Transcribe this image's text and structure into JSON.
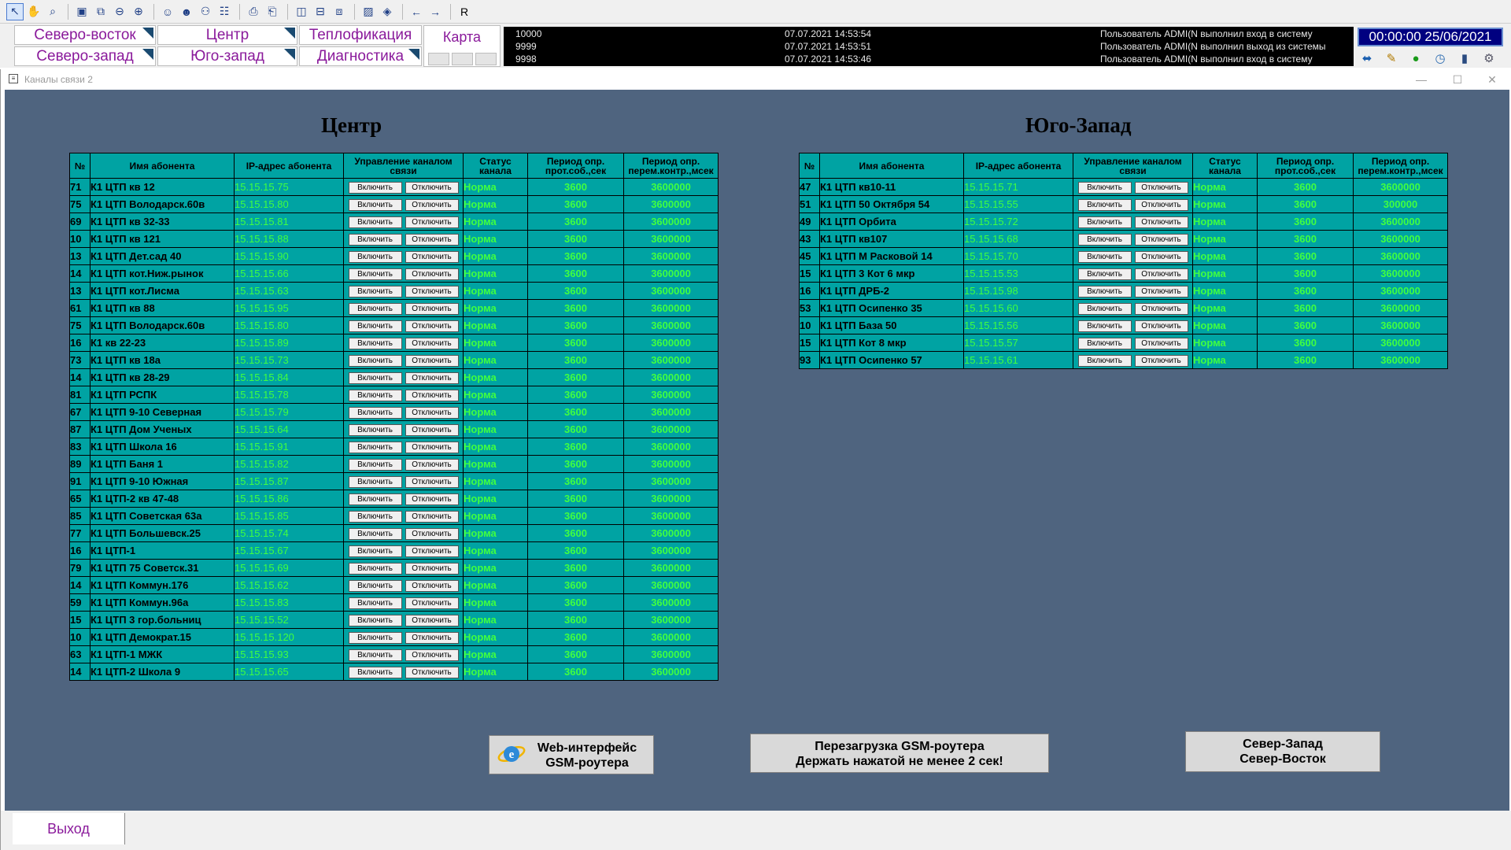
{
  "toolbar": {
    "last_label": "R"
  },
  "nav": {
    "northeast": "Северо-восток",
    "center": "Центр",
    "heating": "Теплофикация",
    "northwest": "Северо-запад",
    "southwest": "Юго-запад",
    "diagnostics": "Диагностика",
    "map": "Карта"
  },
  "eventlog": [
    {
      "code": "10000",
      "time": "07.07.2021 14:53:54",
      "msg": "Пользователь ADMI(N выполнил вход в систему"
    },
    {
      "code": "9999",
      "time": "07.07.2021 14:53:51",
      "msg": "Пользователь ADMI(N выполнил выход из системы"
    },
    {
      "code": "9998",
      "time": "07.07.2021 14:53:46",
      "msg": "Пользователь ADMI(N выполнил вход в систему"
    }
  ],
  "clock": "00:00:00 25/06/2021",
  "window": {
    "title": "Каналы связи 2",
    "minimize": "—",
    "maximize": "☐",
    "close": "✕"
  },
  "headers": {
    "num": "№",
    "name": "Имя абонента",
    "ip": "IP-адрес абонента",
    "ctrl": "Управление каналом связи",
    "status": "Статус канала",
    "p1": "Период опр. прот.соб.,сек",
    "p2": "Период опр. перем.контр.,мсек"
  },
  "buttons": {
    "on": "Включить",
    "off": "Отключить"
  },
  "center": {
    "title": "Центр",
    "rows": [
      {
        "num": "71",
        "name": "К1 ЦТП кв 12",
        "ip": "15.15.15.75",
        "status": "Норма",
        "p1": "3600",
        "p2": "3600000"
      },
      {
        "num": "75",
        "name": "К1 ЦТП Володарск.60в",
        "ip": "15.15.15.80",
        "status": "Норма",
        "p1": "3600",
        "p2": "3600000"
      },
      {
        "num": "69",
        "name": "К1 ЦТП кв 32-33",
        "ip": "15.15.15.81",
        "status": "Норма",
        "p1": "3600",
        "p2": "3600000"
      },
      {
        "num": "10",
        "name": "К1 ЦТП кв 121",
        "ip": "15.15.15.88",
        "status": "Норма",
        "p1": "3600",
        "p2": "3600000"
      },
      {
        "num": "13",
        "name": "К1 ЦТП Дет.сад 40",
        "ip": "15.15.15.90",
        "status": "Норма",
        "p1": "3600",
        "p2": "3600000"
      },
      {
        "num": "14",
        "name": "К1 ЦТП кот.Ниж.рынок",
        "ip": "15.15.15.66",
        "status": "Норма",
        "p1": "3600",
        "p2": "3600000"
      },
      {
        "num": "13",
        "name": "К1 ЦТП кот.Лисма",
        "ip": "15.15.15.63",
        "status": "Норма",
        "p1": "3600",
        "p2": "3600000"
      },
      {
        "num": "61",
        "name": "К1 ЦТП кв 88",
        "ip": "15.15.15.95",
        "status": "Норма",
        "p1": "3600",
        "p2": "3600000"
      },
      {
        "num": "75",
        "name": "К1 ЦТП Володарск.60в",
        "ip": "15.15.15.80",
        "status": "Норма",
        "p1": "3600",
        "p2": "3600000"
      },
      {
        "num": "16",
        "name": "К1 кв 22-23",
        "ip": "15.15.15.89",
        "status": "Норма",
        "p1": "3600",
        "p2": "3600000"
      },
      {
        "num": "73",
        "name": "К1 ЦТП кв 18а",
        "ip": "15.15.15.73",
        "status": "Норма",
        "p1": "3600",
        "p2": "3600000"
      },
      {
        "num": "14",
        "name": "К1 ЦТП кв 28-29",
        "ip": "15.15.15.84",
        "status": "Норма",
        "p1": "3600",
        "p2": "3600000"
      },
      {
        "num": "81",
        "name": "К1 ЦТП РСПК",
        "ip": "15.15.15.78",
        "status": "Норма",
        "p1": "3600",
        "p2": "3600000"
      },
      {
        "num": "67",
        "name": "К1 ЦТП 9-10 Северная",
        "ip": "15.15.15.79",
        "status": "Норма",
        "p1": "3600",
        "p2": "3600000"
      },
      {
        "num": "87",
        "name": "К1 ЦТП Дом Ученых",
        "ip": "15.15.15.64",
        "status": "Норма",
        "p1": "3600",
        "p2": "3600000"
      },
      {
        "num": "83",
        "name": "К1 ЦТП Школа 16",
        "ip": "15.15.15.91",
        "status": "Норма",
        "p1": "3600",
        "p2": "3600000"
      },
      {
        "num": "89",
        "name": "К1 ЦТП Баня 1",
        "ip": "15.15.15.82",
        "status": "Норма",
        "p1": "3600",
        "p2": "3600000"
      },
      {
        "num": "91",
        "name": "К1 ЦТП 9-10 Южная",
        "ip": "15.15.15.87",
        "status": "Норма",
        "p1": "3600",
        "p2": "3600000"
      },
      {
        "num": "65",
        "name": "К1 ЦТП-2 кв 47-48",
        "ip": "15.15.15.86",
        "status": "Норма",
        "p1": "3600",
        "p2": "3600000"
      },
      {
        "num": "85",
        "name": "К1 ЦТП Советская 63а",
        "ip": "15.15.15.85",
        "status": "Норма",
        "p1": "3600",
        "p2": "3600000"
      },
      {
        "num": "77",
        "name": "К1 ЦТП Большевск.25",
        "ip": "15.15.15.74",
        "status": "Норма",
        "p1": "3600",
        "p2": "3600000"
      },
      {
        "num": "16",
        "name": "К1 ЦТП-1",
        "ip": "15.15.15.67",
        "status": "Норма",
        "p1": "3600",
        "p2": "3600000"
      },
      {
        "num": "79",
        "name": "К1 ЦТП 75 Советск.31",
        "ip": "15.15.15.69",
        "status": "Норма",
        "p1": "3600",
        "p2": "3600000"
      },
      {
        "num": "14",
        "name": "К1 ЦТП Коммун.176",
        "ip": "15.15.15.62",
        "status": "Норма",
        "p1": "3600",
        "p2": "3600000"
      },
      {
        "num": "59",
        "name": "К1 ЦТП Коммун.96а",
        "ip": "15.15.15.83",
        "status": "Норма",
        "p1": "3600",
        "p2": "3600000"
      },
      {
        "num": "15",
        "name": "К1 ЦТП 3 гор.больниц",
        "ip": "15.15.15.52",
        "status": "Норма",
        "p1": "3600",
        "p2": "3600000"
      },
      {
        "num": "10",
        "name": "К1 ЦТП Демократ.15",
        "ip": "15.15.15.120",
        "status": "Норма",
        "p1": "3600",
        "p2": "3600000"
      },
      {
        "num": "63",
        "name": "К1 ЦТП-1 МЖК",
        "ip": "15.15.15.93",
        "status": "Норма",
        "p1": "3600",
        "p2": "3600000"
      },
      {
        "num": "14",
        "name": "К1 ЦТП-2 Школа 9",
        "ip": "15.15.15.65",
        "status": "Норма",
        "p1": "3600",
        "p2": "3600000"
      }
    ]
  },
  "southwest": {
    "title": "Юго-Запад",
    "rows": [
      {
        "num": "47",
        "name": "К1 ЦТП кв10-11",
        "ip": "15.15.15.71",
        "status": "Норма",
        "p1": "3600",
        "p2": "3600000"
      },
      {
        "num": "51",
        "name": "К1 ЦТП 50 Октября 54",
        "ip": "15.15.15.55",
        "status": "Норма",
        "p1": "3600",
        "p2": "300000"
      },
      {
        "num": "49",
        "name": "К1 ЦТП Орбита",
        "ip": "15.15.15.72",
        "status": "Норма",
        "p1": "3600",
        "p2": "3600000"
      },
      {
        "num": "43",
        "name": "К1 ЦТП кв107",
        "ip": "15.15.15.68",
        "status": "Норма",
        "p1": "3600",
        "p2": "3600000"
      },
      {
        "num": "45",
        "name": "К1 ЦТП М Расковой 14",
        "ip": "15.15.15.70",
        "status": "Норма",
        "p1": "3600",
        "p2": "3600000"
      },
      {
        "num": "15",
        "name": "К1 ЦТП 3 Кот 6 мкр",
        "ip": "15.15.15.53",
        "status": "Норма",
        "p1": "3600",
        "p2": "3600000"
      },
      {
        "num": "16",
        "name": "К1 ЦТП ДРБ-2",
        "ip": "15.15.15.98",
        "status": "Норма",
        "p1": "3600",
        "p2": "3600000"
      },
      {
        "num": "53",
        "name": "К1 ЦТП Осипенко 35",
        "ip": "15.15.15.60",
        "status": "Норма",
        "p1": "3600",
        "p2": "3600000"
      },
      {
        "num": "10",
        "name": "К1 ЦТП База 50",
        "ip": "15.15.15.56",
        "status": "Норма",
        "p1": "3600",
        "p2": "3600000"
      },
      {
        "num": "15",
        "name": "К1 ЦТП Кот 8 мкр",
        "ip": "15.15.15.57",
        "status": "Норма",
        "p1": "3600",
        "p2": "3600000"
      },
      {
        "num": "93",
        "name": "К1 ЦТП Осипенко 57",
        "ip": "15.15.15.61",
        "status": "Норма",
        "p1": "3600",
        "p2": "3600000"
      }
    ]
  },
  "actions": {
    "web_line1": "Web-интерфейс",
    "web_line2": "GSM-роутера",
    "reboot_line1": "Перезагрузка GSM-роутера",
    "reboot_line2": "Держать нажатой не менее 2 сек!",
    "nav_line1": "Север-Запад",
    "nav_line2": "Север-Восток"
  },
  "footer": {
    "exit": "Выход"
  }
}
